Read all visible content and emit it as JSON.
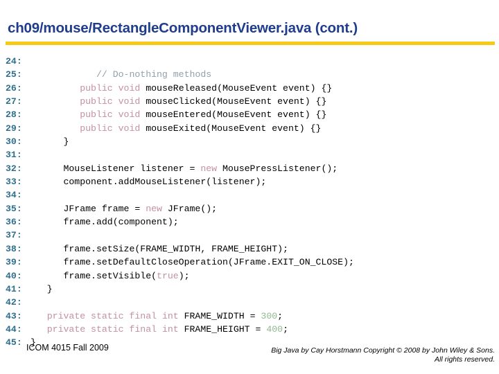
{
  "slide": {
    "title": "ch09/mouse/RectangleComponentViewer.java  (cont.)",
    "accent_rule_color": "#F7CA18",
    "title_color": "#1F3D8C"
  },
  "code": {
    "language": "java",
    "line_number_color": "#2E6E8E",
    "keyword_color": "#C490A0",
    "comment_color": "#8FA0AE",
    "number_color": "#8FB98F",
    "lines": [
      {
        "n": "24:",
        "indent": 0,
        "segments": []
      },
      {
        "n": "25:",
        "indent": 0,
        "segments": [
          {
            "t": "            // Do-nothing methods",
            "c": "cmt"
          }
        ]
      },
      {
        "n": "26:",
        "indent": 0,
        "segments": [
          {
            "t": "         ",
            "c": "code-text"
          },
          {
            "t": "public void",
            "c": "kw"
          },
          {
            "t": " mouseReleased(MouseEvent event) {}",
            "c": "code-text"
          }
        ]
      },
      {
        "n": "27:",
        "indent": 0,
        "segments": [
          {
            "t": "         ",
            "c": "code-text"
          },
          {
            "t": "public void",
            "c": "kw"
          },
          {
            "t": " mouseClicked(MouseEvent event) {}",
            "c": "code-text"
          }
        ]
      },
      {
        "n": "28:",
        "indent": 0,
        "segments": [
          {
            "t": "         ",
            "c": "code-text"
          },
          {
            "t": "public void",
            "c": "kw"
          },
          {
            "t": " mouseEntered(MouseEvent event) {}",
            "c": "code-text"
          }
        ]
      },
      {
        "n": "29:",
        "indent": 0,
        "segments": [
          {
            "t": "         ",
            "c": "code-text"
          },
          {
            "t": "public void",
            "c": "kw"
          },
          {
            "t": " mouseExited(MouseEvent event) {}",
            "c": "code-text"
          }
        ]
      },
      {
        "n": "30:",
        "indent": 0,
        "segments": [
          {
            "t": "      }",
            "c": "code-text"
          }
        ]
      },
      {
        "n": "31:",
        "indent": 0,
        "segments": []
      },
      {
        "n": "32:",
        "indent": 0,
        "segments": [
          {
            "t": "      MouseListener listener = ",
            "c": "code-text"
          },
          {
            "t": "new",
            "c": "kw"
          },
          {
            "t": " MousePressListener();",
            "c": "code-text"
          }
        ]
      },
      {
        "n": "33:",
        "indent": 0,
        "segments": [
          {
            "t": "      component.addMouseListener(listener);",
            "c": "code-text"
          }
        ]
      },
      {
        "n": "34:",
        "indent": 0,
        "segments": []
      },
      {
        "n": "35:",
        "indent": 0,
        "segments": [
          {
            "t": "      JFrame frame = ",
            "c": "code-text"
          },
          {
            "t": "new",
            "c": "kw"
          },
          {
            "t": " JFrame();",
            "c": "code-text"
          }
        ]
      },
      {
        "n": "36:",
        "indent": 0,
        "segments": [
          {
            "t": "      frame.add(component);",
            "c": "code-text"
          }
        ]
      },
      {
        "n": "37:",
        "indent": 0,
        "segments": []
      },
      {
        "n": "38:",
        "indent": 0,
        "segments": [
          {
            "t": "      frame.setSize(FRAME_WIDTH, FRAME_HEIGHT);",
            "c": "code-text"
          }
        ]
      },
      {
        "n": "39:",
        "indent": 0,
        "segments": [
          {
            "t": "      frame.setDefaultCloseOperation(JFrame.EXIT_ON_CLOSE);",
            "c": "code-text"
          }
        ]
      },
      {
        "n": "40:",
        "indent": 0,
        "segments": [
          {
            "t": "      frame.setVisible(",
            "c": "code-text"
          },
          {
            "t": "true",
            "c": "kw"
          },
          {
            "t": ");",
            "c": "code-text"
          }
        ]
      },
      {
        "n": "41:",
        "indent": 0,
        "segments": [
          {
            "t": "   }",
            "c": "code-text"
          }
        ]
      },
      {
        "n": "42:",
        "indent": 0,
        "segments": []
      },
      {
        "n": "43:",
        "indent": 0,
        "segments": [
          {
            "t": "   ",
            "c": "code-text"
          },
          {
            "t": "private static final int",
            "c": "kw"
          },
          {
            "t": " FRAME_WIDTH = ",
            "c": "code-text"
          },
          {
            "t": "300",
            "c": "num"
          },
          {
            "t": ";",
            "c": "code-text"
          }
        ]
      },
      {
        "n": "44:",
        "indent": 0,
        "segments": [
          {
            "t": "   ",
            "c": "code-text"
          },
          {
            "t": "private static final int",
            "c": "kw"
          },
          {
            "t": " FRAME_HEIGHT = ",
            "c": "code-text"
          },
          {
            "t": "400",
            "c": "num"
          },
          {
            "t": ";",
            "c": "code-text"
          }
        ]
      },
      {
        "n": "45:",
        "indent": 0,
        "segments": [
          {
            "t": "}",
            "c": "code-text"
          }
        ]
      }
    ]
  },
  "footer": {
    "left": "ICOM 4015 Fall 2009",
    "right": "Big Java by Cay Horstmann Copyright © 2008 by John Wiley & Sons.  All rights reserved."
  }
}
